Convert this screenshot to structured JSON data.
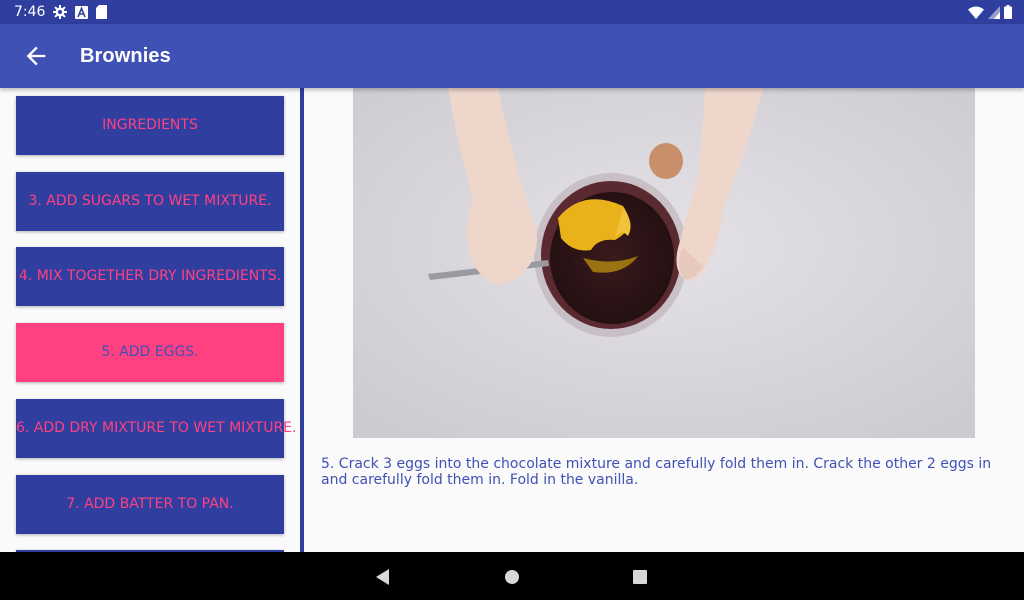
{
  "status_bar": {
    "time": "7:46",
    "left_icons": [
      "settings-icon",
      "a-letter-icon",
      "sd-card-icon"
    ],
    "right_icons": [
      "wifi-icon",
      "signal-icon",
      "battery-icon"
    ]
  },
  "app_bar": {
    "title": "Brownies",
    "back_icon": "arrow-back-icon"
  },
  "steps": [
    {
      "label": "INGREDIENTS",
      "active": false
    },
    {
      "label": "3. ADD SUGARS TO WET MIXTURE.",
      "active": false
    },
    {
      "label": "4. MIX TOGETHER DRY INGREDIENTS.",
      "active": false
    },
    {
      "label": "5. ADD EGGS.",
      "active": true
    },
    {
      "label": "6. ADD DRY MIXTURE TO WET MIXTURE.",
      "active": false
    },
    {
      "label": "7. ADD BATTER TO PAN.",
      "active": false
    }
  ],
  "detail": {
    "description": "5. Crack 3 eggs into the chocolate mixture and carefully fold them in. Crack the other 2 eggs in and carefully fold them in. Fold in the vanilla."
  },
  "colors": {
    "primary": "#3f51b5",
    "primary_dark": "#303f9f",
    "accent": "#ff4081"
  },
  "nav_bar": {
    "icons": [
      "back-triangle-icon",
      "home-circle-icon",
      "recents-square-icon"
    ]
  }
}
